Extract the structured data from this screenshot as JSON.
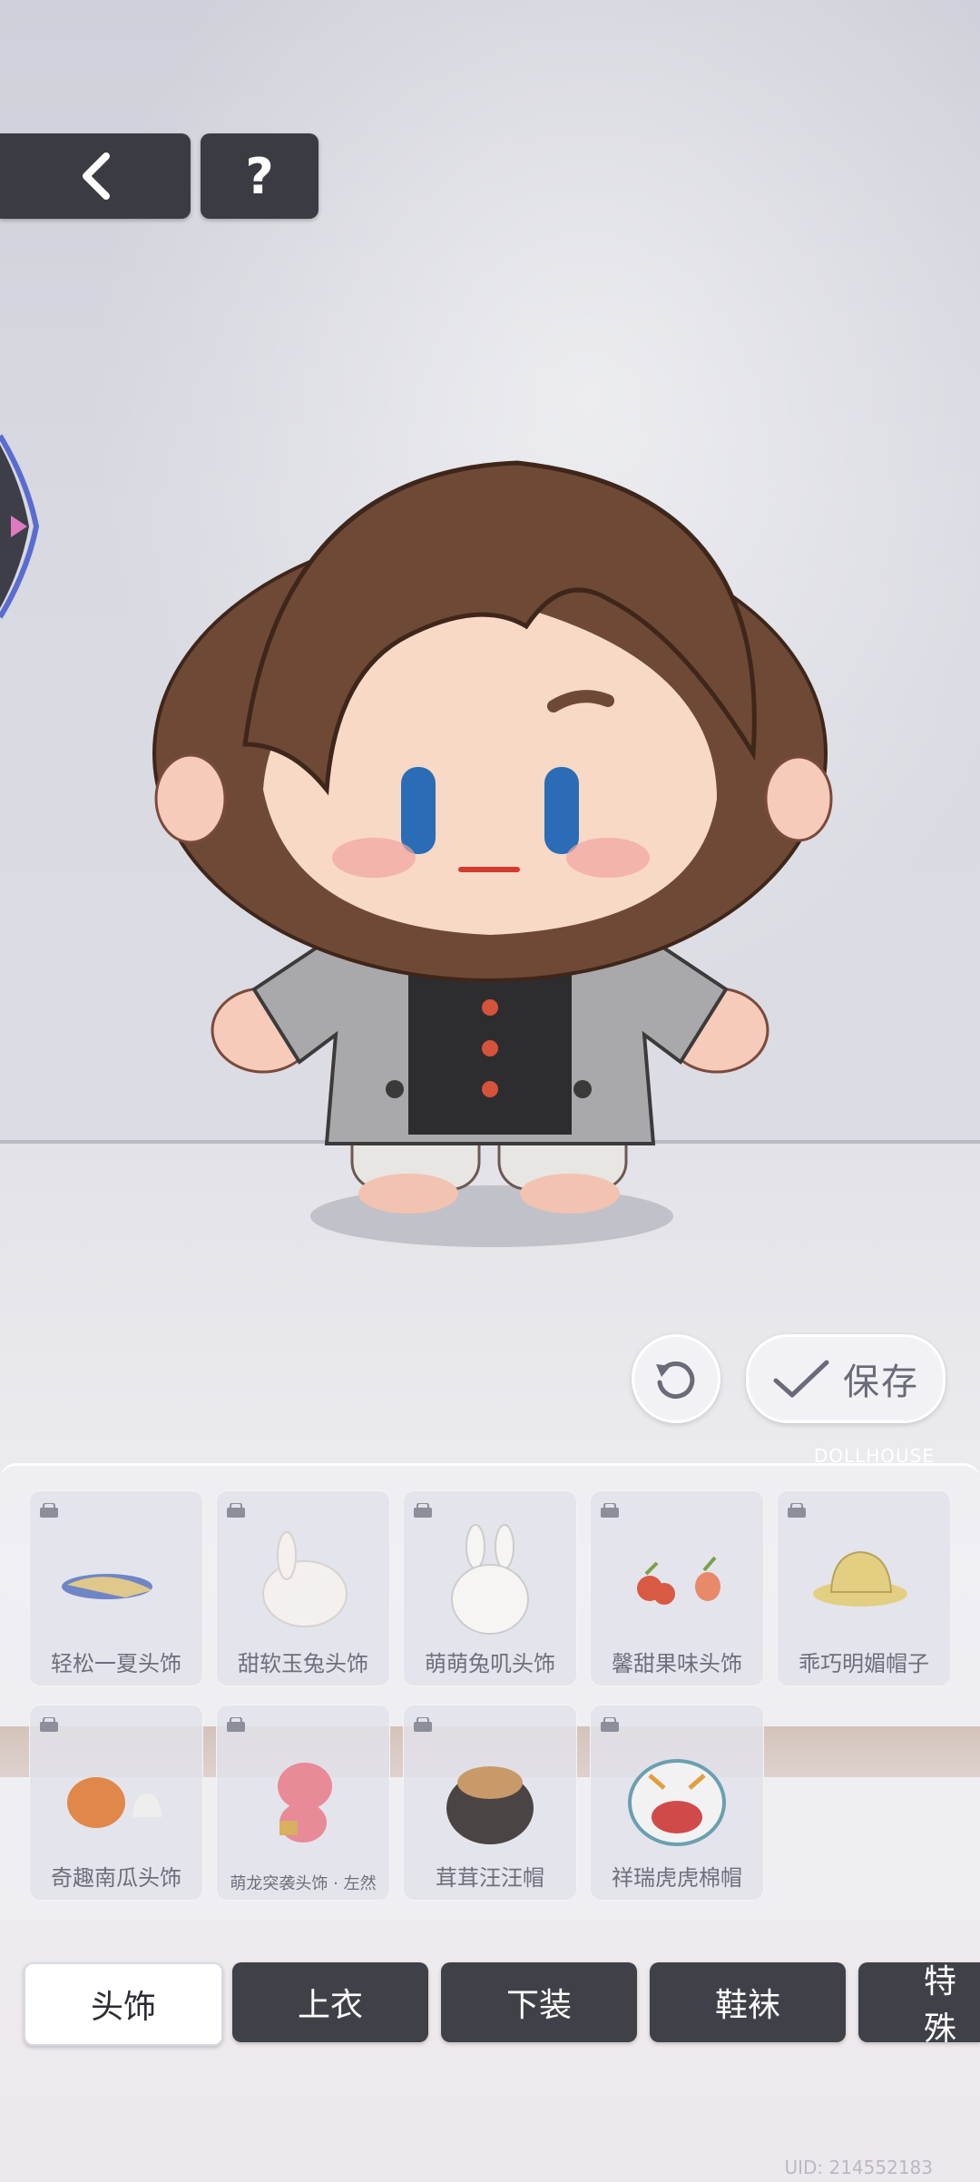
{
  "top_bar": {
    "help_label": "?"
  },
  "actions": {
    "save_label": "保存"
  },
  "panel": {
    "brand": "DOLLHOUSE",
    "items": [
      {
        "label": "轻松一夏头饰",
        "thumb_icon": "cap-icon"
      },
      {
        "label": "甜软玉兔头饰",
        "thumb_icon": "bunny-icon"
      },
      {
        "label": "萌萌兔叽头饰",
        "thumb_icon": "bunny-head-icon"
      },
      {
        "label": "馨甜果味头饰",
        "thumb_icon": "fruit-icon"
      },
      {
        "label": "乖巧明媚帽子",
        "thumb_icon": "sun-hat-icon"
      },
      {
        "label": "奇趣南瓜头饰",
        "thumb_icon": "pumpkin-icon"
      },
      {
        "label": "萌龙突袭头饰 · 左然",
        "thumb_icon": "dragon-icon"
      },
      {
        "label": "茸茸汪汪帽",
        "thumb_icon": "dog-hat-icon"
      },
      {
        "label": "祥瑞虎虎棉帽",
        "thumb_icon": "tiger-hat-icon"
      }
    ]
  },
  "tabs": [
    {
      "label": "头饰",
      "active": true
    },
    {
      "label": "上衣",
      "active": false
    },
    {
      "label": "下装",
      "active": false
    },
    {
      "label": "鞋袜",
      "active": false
    },
    {
      "label": "特殊",
      "active": false
    }
  ],
  "footer": {
    "uid": "UID: 214552183"
  },
  "colors": {
    "button_dark": "#3b3c43",
    "tab_active_bg": "#ffffff",
    "hair": "#6e4a36",
    "eyes": "#2a6cb5"
  }
}
